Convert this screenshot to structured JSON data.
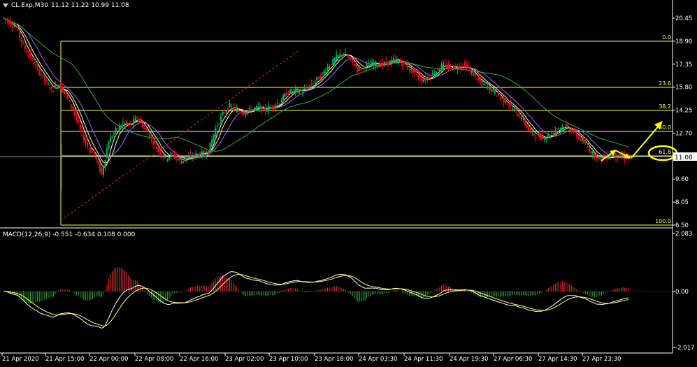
{
  "header": {
    "symbol": "CL.Exp,M30",
    "ohlc": "11.12 11.22 10.99 11.08",
    "dropdown_icon": "triangle-down-icon"
  },
  "macd_header": {
    "label": "MACD(12,26,9) -0.551 -0.634 0.108 0.000"
  },
  "colors": {
    "background": "#000000",
    "axis": "#ffffff",
    "fib": "#ffff66",
    "bull": "#00b050",
    "bear": "#e01010",
    "ma_fast": "#ffffff",
    "ma_mid": "#ffff99",
    "ma_purple": "#9966ff",
    "ma_green": "#33aa33",
    "annotation": "#ffff00",
    "hist_pos": "#e03030",
    "hist_neg": "#30a030"
  },
  "price_axis": {
    "ticks": [
      "20.45",
      "18.90",
      "17.35",
      "15.80",
      "14.25",
      "12.70",
      "11.15",
      "9.60",
      "8.05",
      "6.50"
    ],
    "current": "11.08"
  },
  "macd_axis": {
    "ticks": [
      "2.083",
      "0.00",
      "-2.017"
    ]
  },
  "time_axis": {
    "ticks": [
      "21 Apr 2020",
      "21 Apr 15:00",
      "22 Apr 00:00",
      "22 Apr 08:00",
      "22 Apr 16:00",
      "23 Apr 02:00",
      "23 Apr 10:00",
      "23 Apr 18:00",
      "24 Apr 03:30",
      "24 Apr 11:30",
      "24 Apr 19:30",
      "27 Apr 06:30",
      "27 Apr 14:30",
      "27 Apr 23:30"
    ]
  },
  "fibonacci": {
    "levels": [
      "0.0",
      "23.6",
      "38.2",
      "50.0",
      "61.8",
      "100.0"
    ]
  },
  "chart_data": {
    "type": "candlestick",
    "symbol": "CL.Exp",
    "timeframe": "M30",
    "last": {
      "open": 11.12,
      "high": 11.22,
      "low": 10.99,
      "close": 11.08
    },
    "close_path": [
      20.5,
      20.2,
      19.8,
      18.6,
      17.8,
      17.0,
      16.3,
      15.6,
      16.0,
      15.2,
      14.3,
      12.9,
      11.8,
      11.2,
      9.9,
      12.2,
      12.9,
      13.4,
      13.2,
      13.8,
      13.0,
      12.3,
      11.5,
      11.0,
      11.3,
      10.8,
      11.0,
      11.2,
      11.3,
      11.5,
      13.0,
      14.0,
      14.5,
      14.2,
      14.1,
      14.3,
      14.4,
      14.3,
      14.5,
      14.8,
      15.4,
      15.6,
      15.5,
      15.8,
      16.2,
      16.7,
      17.3,
      17.8,
      18.1,
      17.6,
      17.0,
      17.2,
      17.4,
      17.3,
      17.4,
      17.6,
      17.5,
      17.1,
      16.8,
      16.3,
      16.5,
      16.9,
      17.3,
      17.1,
      17.2,
      17.3,
      16.8,
      16.2,
      15.9,
      15.5,
      15.1,
      14.7,
      14.2,
      13.7,
      12.9,
      12.5,
      12.4,
      12.6,
      13.0,
      13.2,
      12.9,
      12.4,
      11.9,
      11.3,
      11.0,
      11.1,
      11.2,
      11.1,
      11.08
    ],
    "fib_prices": {
      "0.0": 18.9,
      "23.6": 15.8,
      "38.2": 14.25,
      "50.0": 12.8,
      "61.8": 11.15,
      "100.0": 6.5
    },
    "macd": {
      "params": "12,26,9",
      "main": -0.551,
      "signal": -0.634,
      "hist": 0.108,
      "zero": 0.0
    },
    "macd_range": [
      -2.017,
      2.083
    ],
    "price_range": [
      6.5,
      20.45
    ]
  }
}
